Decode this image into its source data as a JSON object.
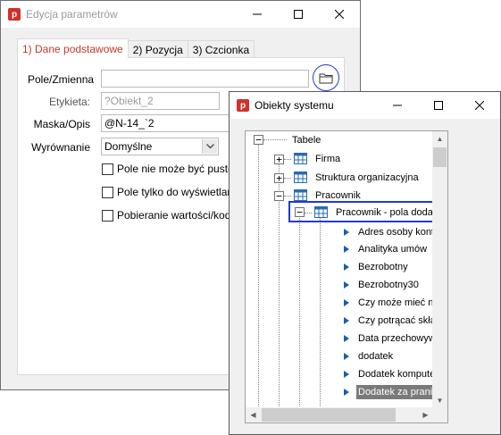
{
  "window_params": {
    "title": "Edycja parametrów",
    "app_icon_letter": "p",
    "tabs": [
      {
        "label": "1) Dane podstawowe",
        "active": true
      },
      {
        "label": "2) Pozycja",
        "active": false
      },
      {
        "label": "3) Czcionka",
        "active": false
      }
    ],
    "fields": {
      "pole_label": "Pole/Zmienna",
      "pole_value": "",
      "etykieta_label": "Etykieta:",
      "etykieta_value": "?Obiekt_2",
      "maska_label": "Maska/Opis",
      "maska_value": "@N-14_`2",
      "wyrownanie_label": "Wyrównanie",
      "wyrownanie_value": "Domyślne"
    },
    "checkboxes": [
      {
        "label": "Pole nie może być puste lub",
        "checked": false
      },
      {
        "label": "Pole tylko do wyświetlania",
        "checked": false
      },
      {
        "label": "Pobieranie wartości/kodu z",
        "checked": false
      }
    ],
    "icons": {
      "folder": "folder-icon"
    }
  },
  "window_objects": {
    "title": "Obiekty systemu",
    "app_icon_letter": "p",
    "tree": {
      "root": "Tabele",
      "nodes": [
        {
          "label": "Firma",
          "expanded": false
        },
        {
          "label": "Struktura organizacyjna",
          "expanded": false
        },
        {
          "label": "Pracownik",
          "expanded": true
        }
      ],
      "subnode": "Pracownik - pola dodatkowe",
      "leaves": [
        "Adres osoby kontaktowej",
        "Analityka umów",
        "Bezrobotny",
        "Bezrobotny30",
        "Czy może mieć nadgodziny",
        "Czy potrącać składki",
        "Data przechowywania",
        "dodatek",
        "Dodatek komputerowy",
        "Dodatek za pranie"
      ],
      "selected_leaf": "Dodatek za pranie"
    }
  },
  "colors": {
    "accent_red": "#c0392b",
    "highlight_blue": "#1f3ad6",
    "bullet_blue": "#1b5ea6"
  }
}
